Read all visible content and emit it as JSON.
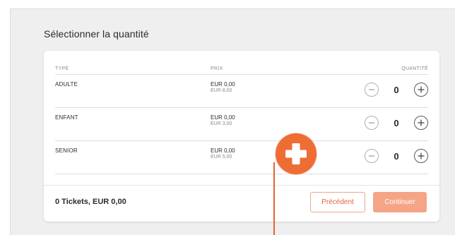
{
  "section": {
    "title": "Sélectionner la quantité"
  },
  "table": {
    "headers": {
      "type": "TYPE",
      "price": "PRIX",
      "quantity": "QUANTITÉ"
    },
    "rows": [
      {
        "type": "ADULTE",
        "price": "EUR 0,00",
        "price_sub": "EUR 8,00",
        "quantity": "0"
      },
      {
        "type": "ENFANT",
        "price": "EUR 0,00",
        "price_sub": "EUR 3,00",
        "quantity": "0"
      },
      {
        "type": "SENIOR",
        "price": "EUR 0,00",
        "price_sub": "EUR 5,00",
        "quantity": "0"
      }
    ]
  },
  "footer": {
    "summary": "0 Tickets, EUR 0,00",
    "previous_label": "Précédent",
    "continue_label": "Continuer"
  },
  "colors": {
    "accent": "#ee6d35",
    "button_primary": "#f5a585",
    "button_outline_text": "#e4633a"
  },
  "icons": {
    "minus": "minus-circle-icon",
    "plus": "plus-circle-icon",
    "marker": "plus-marker-icon"
  }
}
